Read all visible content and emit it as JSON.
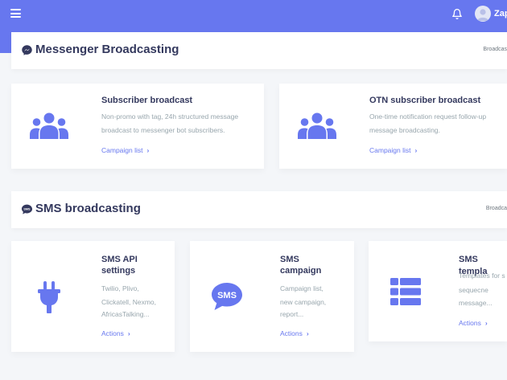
{
  "topbar": {
    "user_name": "Zap"
  },
  "sections": {
    "messenger": {
      "title": "Messenger Broadcasting",
      "crumb": "Broadcas"
    },
    "sms": {
      "title": "SMS broadcasting",
      "crumb": "Broadca"
    }
  },
  "cards": {
    "subscriber": {
      "title": "Subscriber broadcast",
      "desc_1": "Non-promo with tag, 24h structured message",
      "desc_2": "broadcast to messenger bot subscribers.",
      "link": "Campaign list"
    },
    "otn": {
      "title": "OTN subscriber broadcast",
      "desc_1": "One-time notification request follow-up",
      "desc_2": "message broadcasting.",
      "link": "Campaign list"
    },
    "sms_api": {
      "title_1": "SMS API",
      "title_2": "settings",
      "desc_1": "Twilio, Plivo,",
      "desc_2": "Clickatell, Nexmo,",
      "desc_3": "AfricasTalking...",
      "link": "Actions"
    },
    "sms_campaign": {
      "title_1": "SMS",
      "title_2": "campaign",
      "desc_1": "Campaign list,",
      "desc_2": "new campaign,",
      "desc_3": "report...",
      "link": "Actions",
      "icon_text": "SMS"
    },
    "sms_template": {
      "title_1": "SMS templa",
      "desc_1": "Templates for s",
      "desc_2": "sequecne",
      "desc_3": "message...",
      "link": "Actions"
    }
  },
  "colors": {
    "primary": "#6777ef",
    "title": "#34395e",
    "muted": "#98a6ad"
  }
}
